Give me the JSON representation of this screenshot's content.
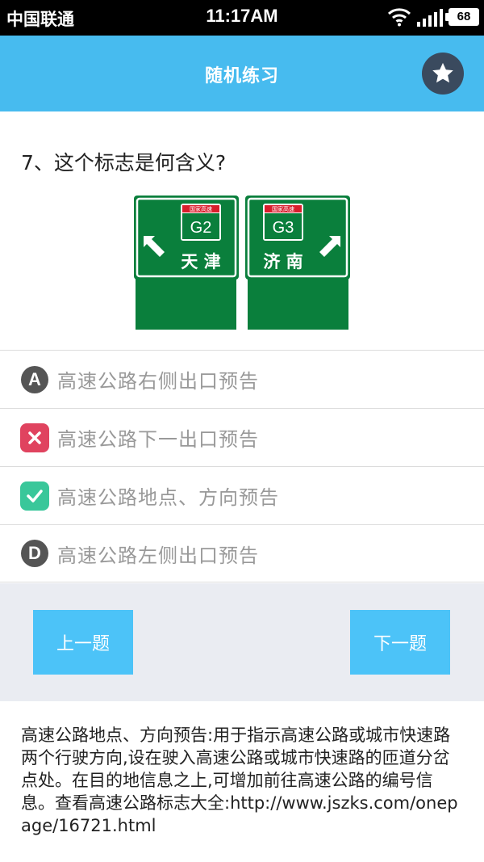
{
  "status_bar": {
    "carrier": "中国联通",
    "time": "11:17AM",
    "battery": "68"
  },
  "header": {
    "title": "随机练习",
    "favorite_icon": "star-icon"
  },
  "question": {
    "text": "7、这个标志是何含义?",
    "sign": {
      "left": {
        "badge": "国家高速",
        "code": "G2",
        "city": "天 津",
        "arrow": "up-left"
      },
      "right": {
        "badge": "国家高速",
        "code": "G3",
        "city": "济 南",
        "arrow": "up-right"
      },
      "colors": {
        "panel": "#0a7f3c",
        "badge_top": "#d81e2c"
      }
    }
  },
  "options": [
    {
      "marker": "A",
      "state": "default",
      "text": "高速公路右侧出口预告"
    },
    {
      "marker": "x-icon",
      "state": "wrong",
      "text": "高速公路下一出口预告"
    },
    {
      "marker": "check-icon",
      "state": "correct",
      "text": "高速公路地点、方向预告"
    },
    {
      "marker": "D",
      "state": "default",
      "text": "高速公路左侧出口预告"
    }
  ],
  "navigation": {
    "prev_label": "上一题",
    "next_label": "下一题"
  },
  "explanation": "高速公路地点、方向预告:用于指示高速公路或城市快速路两个行驶方向,设在驶入高速公路或城市快速路的匝道分岔点处。在目的地信息之上,可增加前往高速公路的编号信息。查看高速公路标志大全:http://www.jszks.com/onepage/16721.html",
  "colors": {
    "header": "#47bbef",
    "nav_button": "#4cc3f8",
    "wrong": "#e0435f",
    "correct": "#39c79a"
  }
}
